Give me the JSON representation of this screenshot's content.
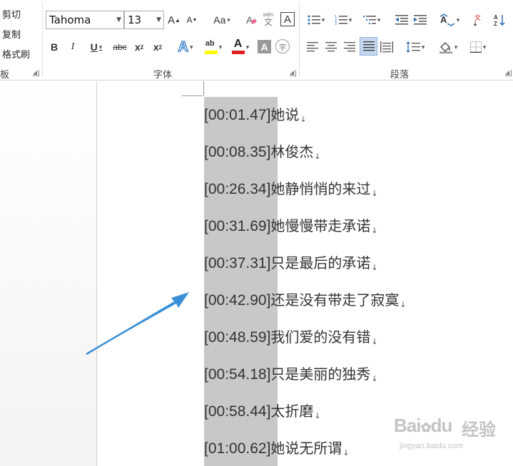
{
  "clipboard": {
    "items": [
      "剪切",
      "复制",
      "格式刷"
    ],
    "label_fragment": "板"
  },
  "font": {
    "label": "字体",
    "name": "Tahoma",
    "size": "13",
    "grow_label": "A",
    "shrink_label": "A",
    "case_label": "Aa",
    "phonetic_top": "wén",
    "phonetic_bottom": "文",
    "border_char": "A",
    "bold": "B",
    "italic": "I",
    "underline": "U",
    "strike": "abc",
    "subscript": "x",
    "subscript_mark": "2",
    "superscript": "x",
    "superscript_mark": "2",
    "effects": "A",
    "highlight_text": "ab",
    "font_color_char": "A",
    "shading_char": "A",
    "enclose_char": "字",
    "highlight_color": "#ffff00",
    "font_color": "#e02020"
  },
  "paragraph": {
    "label": "段落"
  },
  "colors": {
    "accent_blue": "#3b8fd6",
    "selection_gray": "#c8c8c8"
  },
  "lyrics": [
    {
      "time": "[00:01.47]",
      "text": "她说"
    },
    {
      "time": "[00:08.35]",
      "text": "林俊杰"
    },
    {
      "time": "[00:26.34]",
      "text": "她静悄悄的来过"
    },
    {
      "time": "[00:31.69]",
      "text": "她慢慢带走承诺"
    },
    {
      "time": "[00:37.31]",
      "text": "只是最后的承诺"
    },
    {
      "time": "[00:42.90]",
      "text": "还是没有带走了寂寞"
    },
    {
      "time": "[00:48.59]",
      "text": "我们爱的没有错"
    },
    {
      "time": "[00:54.18]",
      "text": "只是美丽的独秀"
    },
    {
      "time": "[00:58.44]",
      "text": "太折磨"
    },
    {
      "time": "[01:00.62]",
      "text": "她说无所谓"
    }
  ],
  "paragraph_mark": "↓",
  "watermark": {
    "brand": "Bai",
    "brand_paw": "du",
    "brand_cn": "经验",
    "url": "jingyan.baidu.com"
  }
}
